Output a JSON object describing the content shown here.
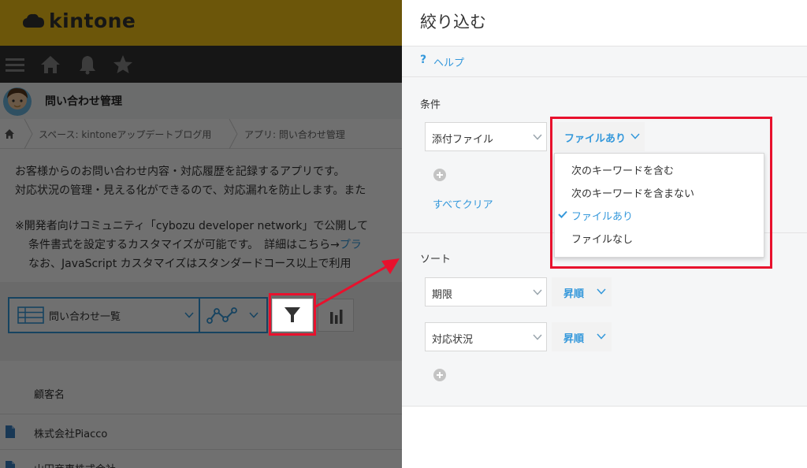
{
  "app": {
    "logo_text": "kintone",
    "nav_icons": [
      "menu-icon",
      "home-icon",
      "bell-icon",
      "star-icon"
    ],
    "app_name": "問い合わせ管理",
    "breadcrumb": {
      "space": "スペース: kintoneアップデートブログ用",
      "app": "アプリ: 問い合わせ管理"
    },
    "description": {
      "line1": "お客様からのお問い合わせ内容・対応履歴を記録するアプリです。",
      "line2": "対応状況の管理・見える化ができるので、対応漏れを防止します。また",
      "line3": "※開発者向けコミュニティ「cybozu developer network」で公開して",
      "line4_text": "条件書式を設定するカスタマイズが可能です。　詳細はこちら→",
      "line4_link": "プラ",
      "line5": "なお、JavaScript カスタマイズはスタンダードコース以上で利用"
    },
    "view_selector": "問い合わせ一覧",
    "table": {
      "header": "顧客名",
      "rows": [
        "株式会社Piacco",
        "山田商事株式会社"
      ]
    }
  },
  "dialog": {
    "title": "絞り込む",
    "help": "ヘルプ",
    "conditions_label": "条件",
    "condition": {
      "field": "添付ファイル",
      "operator": "ファイルあり"
    },
    "clear_all": "すべてクリア",
    "dropdown_options": [
      {
        "label": "次のキーワードを含む",
        "selected": false
      },
      {
        "label": "次のキーワードを含まない",
        "selected": false
      },
      {
        "label": "ファイルあり",
        "selected": true
      },
      {
        "label": "ファイルなし",
        "selected": false
      }
    ],
    "sort_label": "ソート",
    "sorts": [
      {
        "field": "期限",
        "order": "昇順"
      },
      {
        "field": "対応状況",
        "order": "昇順"
      }
    ]
  },
  "colors": {
    "kintone_yellow": "#f5c518",
    "accent_blue": "#3498db",
    "highlight_red": "#e8112d"
  }
}
